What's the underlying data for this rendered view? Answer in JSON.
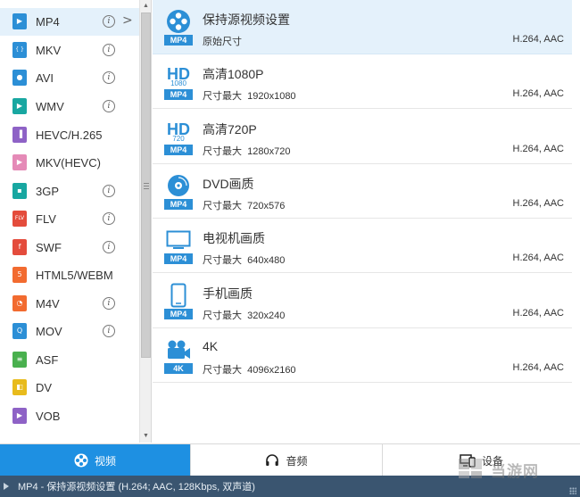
{
  "format_list": {
    "items": [
      {
        "label": "MP4",
        "icon": "mp4-file-icon",
        "color": "#2c8fd6",
        "has_info": true,
        "selected": true
      },
      {
        "label": "MKV",
        "icon": "mkv-file-icon",
        "color": "#2c8fd6",
        "has_info": true
      },
      {
        "label": "AVI",
        "icon": "avi-file-icon",
        "color": "#2c8fd6",
        "has_info": true
      },
      {
        "label": "WMV",
        "icon": "wmv-file-icon",
        "color": "#18a7a1",
        "has_info": true
      },
      {
        "label": "HEVC/H.265",
        "icon": "hevc-file-icon",
        "color": "#8e62c6",
        "has_info": false
      },
      {
        "label": "MKV(HEVC)",
        "icon": "mkv-hevc-file-icon",
        "color": "#e58ab7",
        "has_info": false
      },
      {
        "label": "3GP",
        "icon": "3gp-file-icon",
        "color": "#18a7a1",
        "has_info": true
      },
      {
        "label": "FLV",
        "icon": "flv-file-icon",
        "color": "#e44c3c",
        "has_info": true
      },
      {
        "label": "SWF",
        "icon": "swf-file-icon",
        "color": "#e44c3c",
        "has_info": true
      },
      {
        "label": "HTML5/WEBM",
        "icon": "html5-file-icon",
        "color": "#f26b30",
        "has_info": false
      },
      {
        "label": "M4V",
        "icon": "m4v-file-icon",
        "color": "#f26b30",
        "has_info": true
      },
      {
        "label": "MOV",
        "icon": "mov-file-icon",
        "color": "#2c8fd6",
        "has_info": true
      },
      {
        "label": "ASF",
        "icon": "asf-file-icon",
        "color": "#49b04e",
        "has_info": false
      },
      {
        "label": "DV",
        "icon": "dv-file-icon",
        "color": "#e8bb1c",
        "has_info": false
      },
      {
        "label": "VOB",
        "icon": "vob-file-icon",
        "color": "#8e62c6",
        "has_info": false
      }
    ],
    "info_glyph": "i",
    "chevron_glyph": ">"
  },
  "presets": [
    {
      "title": "保持源视频设置",
      "size": "原始尺寸",
      "codec": "H.264, AAC",
      "tag": "MP4",
      "icon": "film-reel-icon",
      "selected": true
    },
    {
      "title": "高清1080P",
      "size": "尺寸最大  1920x1080",
      "codec": "H.264, AAC",
      "tag": "MP4",
      "icon": "hd-1080-icon",
      "hd_text": "HD",
      "hd_sub": "1080"
    },
    {
      "title": "高清720P",
      "size": "尺寸最大  1280x720",
      "codec": "H.264, AAC",
      "tag": "MP4",
      "icon": "hd-720-icon",
      "hd_text": "HD",
      "hd_sub": "720"
    },
    {
      "title": "DVD画质",
      "size": "尺寸最大  720x576",
      "codec": "H.264, AAC",
      "tag": "MP4",
      "icon": "dvd-disc-icon"
    },
    {
      "title": "电视机画质",
      "size": "尺寸最大  640x480",
      "codec": "H.264, AAC",
      "tag": "MP4",
      "icon": "tv-monitor-icon"
    },
    {
      "title": "手机画质",
      "size": "尺寸最大  320x240",
      "codec": "H.264, AAC",
      "tag": "MP4",
      "icon": "smartphone-icon"
    },
    {
      "title": "4K",
      "size": "尺寸最大  4096x2160",
      "codec": "H.264, AAC",
      "tag": "4K",
      "icon": "video-camera-icon"
    }
  ],
  "tabs": [
    {
      "label": "视频",
      "icon": "film-reel-icon",
      "active": true
    },
    {
      "label": "音频",
      "icon": "headphones-icon",
      "active": false
    },
    {
      "label": "设备",
      "icon": "devices-icon",
      "active": false
    }
  ],
  "status_bar": {
    "text": "MP4 - 保持源视频设置 (H.264; AAC, 128Kbps, 双声道)"
  },
  "watermark": {
    "text": "当游网"
  },
  "colors": {
    "accent": "#1e90e2",
    "icon_blue": "#2c8fd6",
    "selected_bg": "#e4f1fb",
    "status_bg": "#3a5570"
  }
}
